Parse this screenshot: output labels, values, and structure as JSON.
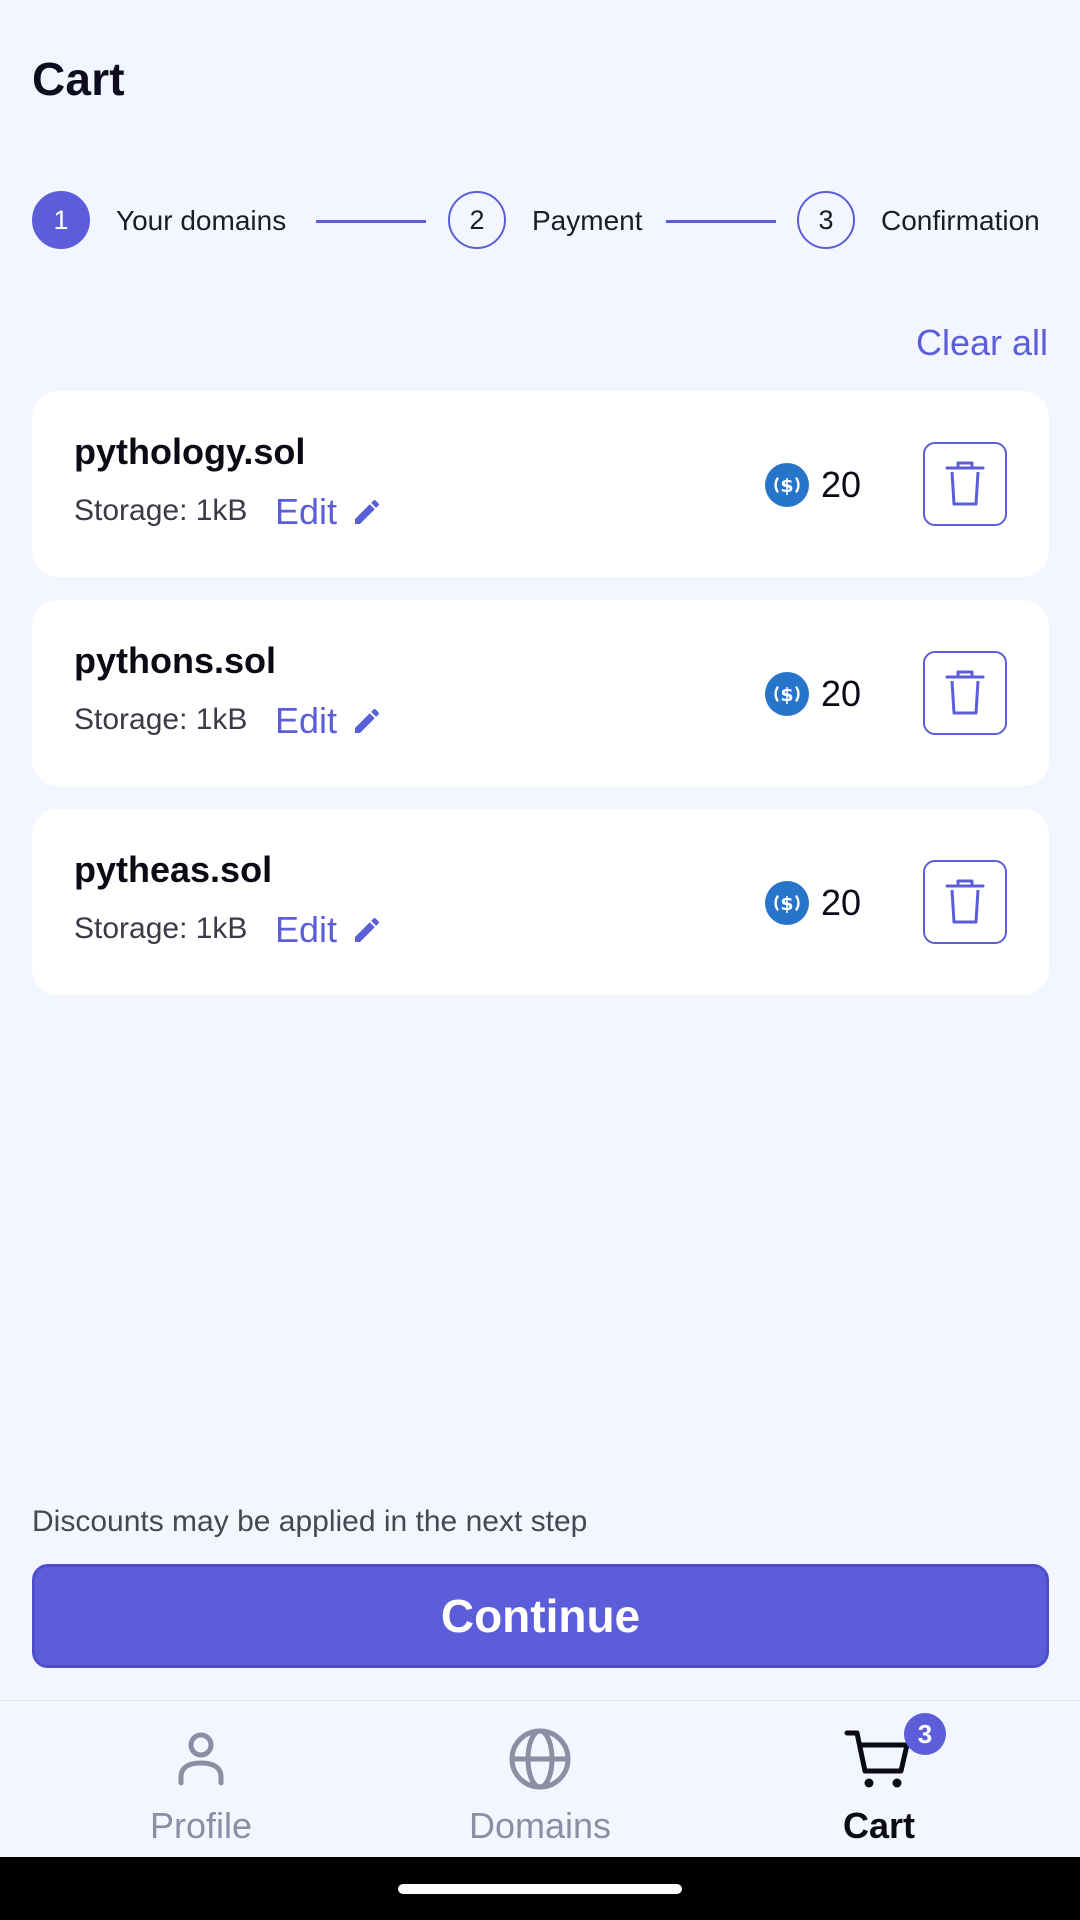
{
  "header": {
    "title": "Cart"
  },
  "stepper": {
    "steps": [
      {
        "number": "1",
        "label": "Your domains",
        "active": true
      },
      {
        "number": "2",
        "label": "Payment",
        "active": false
      },
      {
        "number": "3",
        "label": "Confirmation",
        "active": false
      }
    ]
  },
  "actions": {
    "clear_all_label": "Clear all"
  },
  "cart": {
    "items": [
      {
        "name": "pythology.sol",
        "storage": "Storage: 1kB",
        "edit_label": "Edit",
        "price": "20"
      },
      {
        "name": "pythons.sol",
        "storage": "Storage: 1kB",
        "edit_label": "Edit",
        "price": "20"
      },
      {
        "name": "pytheas.sol",
        "storage": "Storage: 1kB",
        "edit_label": "Edit",
        "price": "20"
      }
    ]
  },
  "footer": {
    "discount_note": "Discounts may be applied in the next step",
    "continue_label": "Continue"
  },
  "bottom_nav": {
    "items": [
      {
        "label": "Profile",
        "icon": "person-icon"
      },
      {
        "label": "Domains",
        "icon": "globe-icon"
      },
      {
        "label": "Cart",
        "icon": "cart-icon",
        "badge": "3",
        "active": true
      }
    ]
  },
  "colors": {
    "accent": "#5c5ed9",
    "background": "#f3f6fe",
    "card": "#ffffff",
    "usdc_blue": "#2775ca",
    "nav_inactive": "#8a8fa3"
  }
}
